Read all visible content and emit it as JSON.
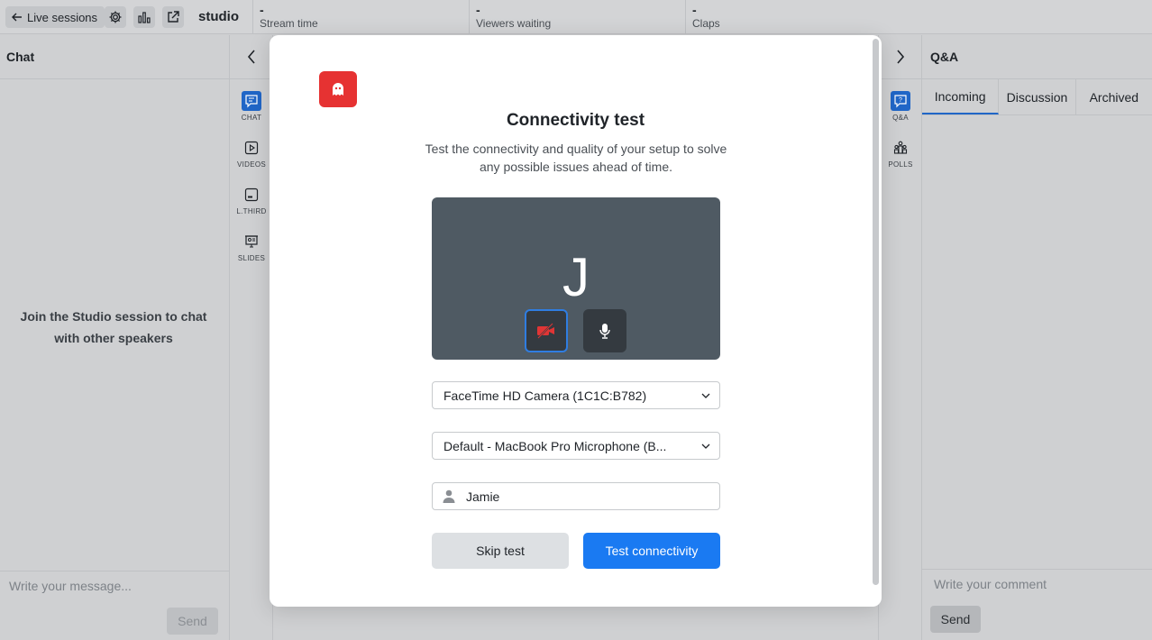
{
  "topbar": {
    "back_label": "Live sessions",
    "studio_title": "studio",
    "stats": [
      {
        "value": "-",
        "label": "Stream time"
      },
      {
        "value": "-",
        "label": "Viewers waiting"
      },
      {
        "value": "-",
        "label": "Claps"
      }
    ]
  },
  "chat": {
    "title": "Chat",
    "empty_message": "Join the Studio session to chat with other speakers",
    "input_placeholder": "Write your message...",
    "send_label": "Send"
  },
  "left_rail": {
    "items": [
      {
        "label": "CHAT",
        "icon": "chat-icon",
        "active": true
      },
      {
        "label": "VIDEOS",
        "icon": "video-icon",
        "active": false
      },
      {
        "label": "L.THIRD",
        "icon": "lower-third-icon",
        "active": false
      },
      {
        "label": "SLIDES",
        "icon": "slides-icon",
        "active": false
      }
    ]
  },
  "right_rail": {
    "items": [
      {
        "label": "Q&A",
        "icon": "qa-icon",
        "active": true
      },
      {
        "label": "POLLS",
        "icon": "polls-icon",
        "active": false
      }
    ]
  },
  "qa": {
    "title": "Q&A",
    "tabs": [
      {
        "label": "Incoming",
        "active": true
      },
      {
        "label": "Discussion",
        "active": false
      },
      {
        "label": "Archived",
        "active": false
      }
    ],
    "input_placeholder": "Write your comment",
    "send_label": "Send"
  },
  "modal": {
    "title": "Connectivity test",
    "description": "Test the connectivity and quality of your setup to solve any possible issues ahead of time.",
    "avatar_letter": "J",
    "camera_select": "FaceTime HD Camera (1C1C:B782)",
    "mic_select": "Default - MacBook Pro Microphone (B...",
    "name_value": "Jamie",
    "skip_label": "Skip test",
    "test_label": "Test connectivity"
  },
  "colors": {
    "accent": "#1a7af2",
    "logo": "#e63232",
    "camera_off": "#e03535"
  }
}
